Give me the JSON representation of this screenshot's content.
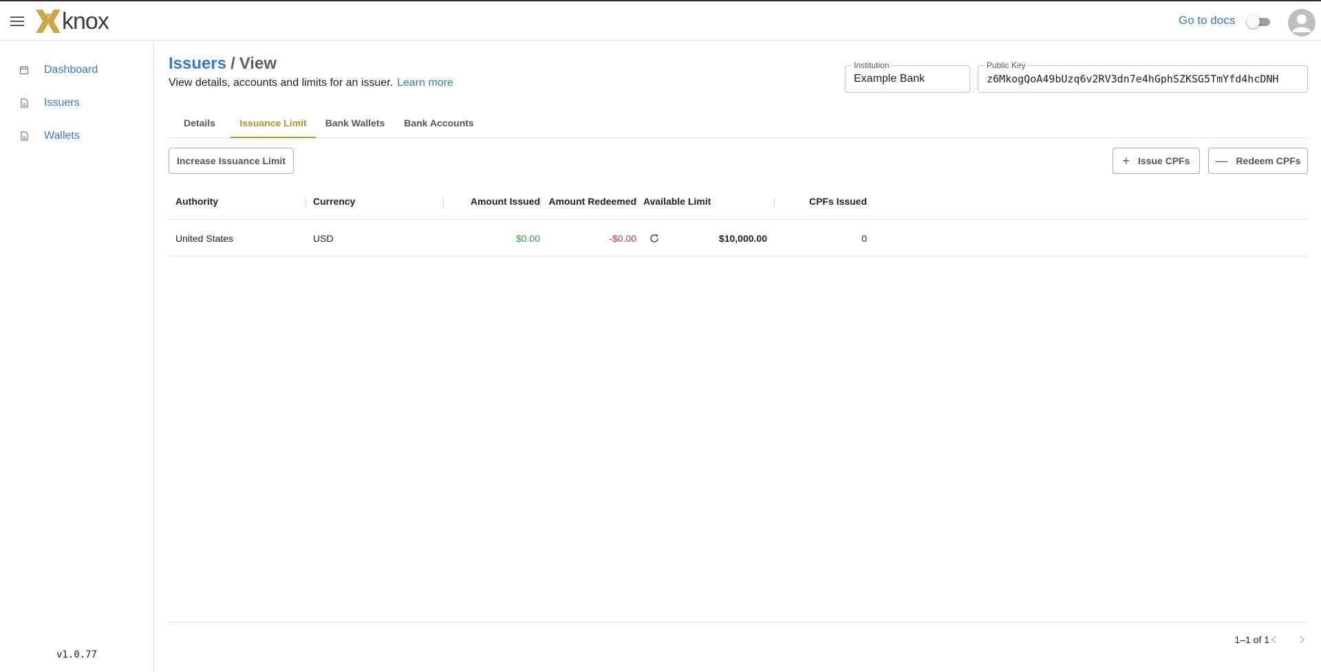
{
  "app": {
    "brand": "knox",
    "brand_color": "#c9a84c",
    "link_color": "#3478d6",
    "accent_color": "#b8922e"
  },
  "topbar": {
    "docs_label": "Go to docs",
    "theme_toggle_on": false
  },
  "sidebar": {
    "items": [
      {
        "label": "Dashboard",
        "icon": "calendar-icon"
      },
      {
        "label": "Issuers",
        "icon": "document-icon"
      },
      {
        "label": "Wallets",
        "icon": "document-icon"
      }
    ],
    "version": "v1.0.77"
  },
  "header": {
    "breadcrumb_link": "Issuers",
    "breadcrumb_sep": "/",
    "breadcrumb_current": "View",
    "subtitle": "View details, accounts and limits for an issuer.",
    "learn_more": "Learn more"
  },
  "fields": {
    "institution": {
      "label": "Institution",
      "value": "Example Bank"
    },
    "public_key": {
      "label": "Public Key",
      "value": "z6MkogQoA49bUzq6v2RV3dn7e4hGphSZKSG5TmYfd4hcDNH"
    }
  },
  "tabs": [
    {
      "label": "Details",
      "active": false
    },
    {
      "label": "Issuance Limit",
      "active": true
    },
    {
      "label": "Bank Wallets",
      "active": false
    },
    {
      "label": "Bank Accounts",
      "active": false
    }
  ],
  "actions": {
    "increase_limit": "Increase Issuance Limit",
    "issue": {
      "label": "Issue CPFs",
      "icon": "plus-icon"
    },
    "redeem": {
      "label": "Redeem CPFs",
      "icon": "minus-icon"
    }
  },
  "table": {
    "columns": [
      "Authority",
      "Currency",
      "Amount Issued",
      "Amount Redeemed",
      "Available Limit",
      "CPFs Issued"
    ],
    "rows": [
      {
        "authority": "United States",
        "currency": "USD",
        "amount_issued": "$0.00",
        "amount_redeemed": "-$0.00",
        "available_limit": "$10,000.00",
        "cpfs_issued": "0"
      }
    ]
  },
  "pagination": {
    "range": "1–1 of 1"
  }
}
